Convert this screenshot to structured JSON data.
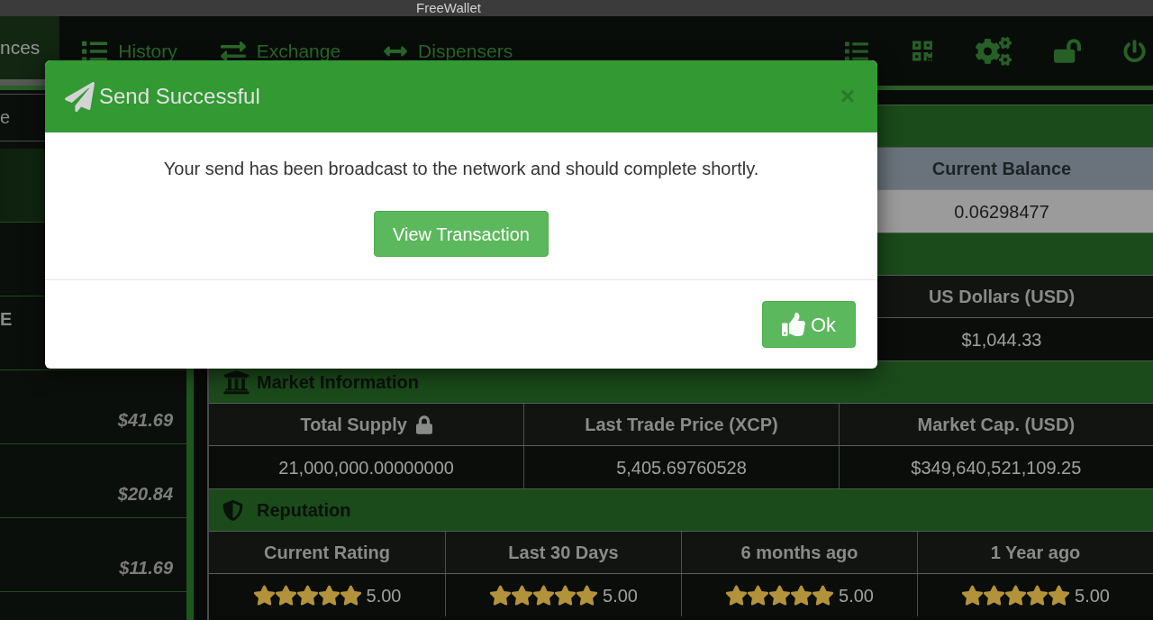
{
  "window": {
    "title": "FreeWallet"
  },
  "nav": {
    "tabs": [
      {
        "label": "nces",
        "selected": true
      },
      {
        "label": "History",
        "selected": false
      },
      {
        "label": "Exchange",
        "selected": false
      },
      {
        "label": "Dispensers",
        "selected": false
      }
    ]
  },
  "sidebar": {
    "filter": {
      "placeholder": "e"
    },
    "items": [
      {
        "selected": true
      },
      {
        "selected": false
      },
      {
        "label": "E",
        "selected": false
      },
      {
        "value": "$41.69",
        "selected": false
      },
      {
        "value": "$20.84",
        "selected": false
      },
      {
        "value": "$11.69",
        "selected": false
      }
    ]
  },
  "main": {
    "sections": [
      {
        "kind": "balance",
        "columns": [
          "Current Balance"
        ],
        "rows": [
          [
            "0.06298477"
          ]
        ]
      },
      {
        "kind": "fiat",
        "columns": [
          "US Dollars (USD)"
        ],
        "rows": [
          [
            "$1,044.33"
          ]
        ]
      },
      {
        "kind": "market",
        "title": "Market Information",
        "columns": [
          {
            "label": "Total Supply",
            "locked": true
          },
          {
            "label": "Last Trade Price (XCP)",
            "locked": false
          },
          {
            "label": "Market Cap. (USD)",
            "locked": false
          }
        ],
        "rows": [
          [
            "21,000,000.00000000",
            "5,405.69760528",
            "$349,640,521,109.25"
          ]
        ]
      },
      {
        "kind": "reputation",
        "title": "Reputation",
        "ratings": [
          {
            "label": "Current Rating",
            "stars": 5,
            "score": "5.00"
          },
          {
            "label": "Last 30 Days",
            "stars": 5,
            "score": "5.00"
          },
          {
            "label": "6 months ago",
            "stars": 5,
            "score": "5.00"
          },
          {
            "label": "1 Year ago",
            "stars": 5,
            "score": "5.00"
          }
        ]
      }
    ]
  },
  "modal": {
    "title": "Send Successful",
    "close": "×",
    "message": "Your send has been broadcast to the network and should complete shortly.",
    "action": "View Transaction",
    "confirm": "Ok"
  }
}
